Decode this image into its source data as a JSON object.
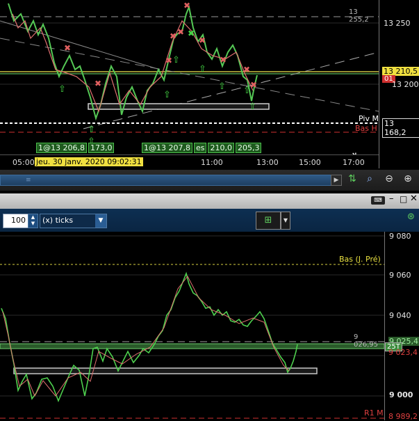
{
  "top_chart": {
    "y_ticks": [
      "13 250",
      "13 200"
    ],
    "price_current": "13 210,5",
    "price_pivot": "13 168,2",
    "level_dash": "13 255,2",
    "label_piv": "Piv M",
    "label_bas": "Bas H",
    "small_tag": "01",
    "time_ticks": [
      "05:00",
      "11:00",
      "13:00",
      "15:00",
      "17:00"
    ],
    "crosshair_time": "jeu. 30 janv. 2020 09:02:31",
    "order_tags": [
      "1@13 206,8",
      "173,0",
      "1@13 207,8",
      "es",
      "210,0",
      "205,3"
    ]
  },
  "bottom_window": {
    "qty_value": "100",
    "interval_select": "(x) ticks",
    "y_ticks": [
      "9 080",
      "9 060",
      "9 040",
      "9 020",
      "9 000"
    ],
    "level_bas": "Bas (J. Pré)",
    "level_dash": "9 026,95",
    "price_green": "9 025,4",
    "price_red": "9 023,4",
    "label_25t": "25T",
    "label_r1": "R1 M",
    "price_r1": "8 989,2"
  },
  "colors": {
    "up": "#3cd23c",
    "down": "#e86a6a",
    "yellow": "#f0e040",
    "accent_blue": "#1e4d80"
  }
}
